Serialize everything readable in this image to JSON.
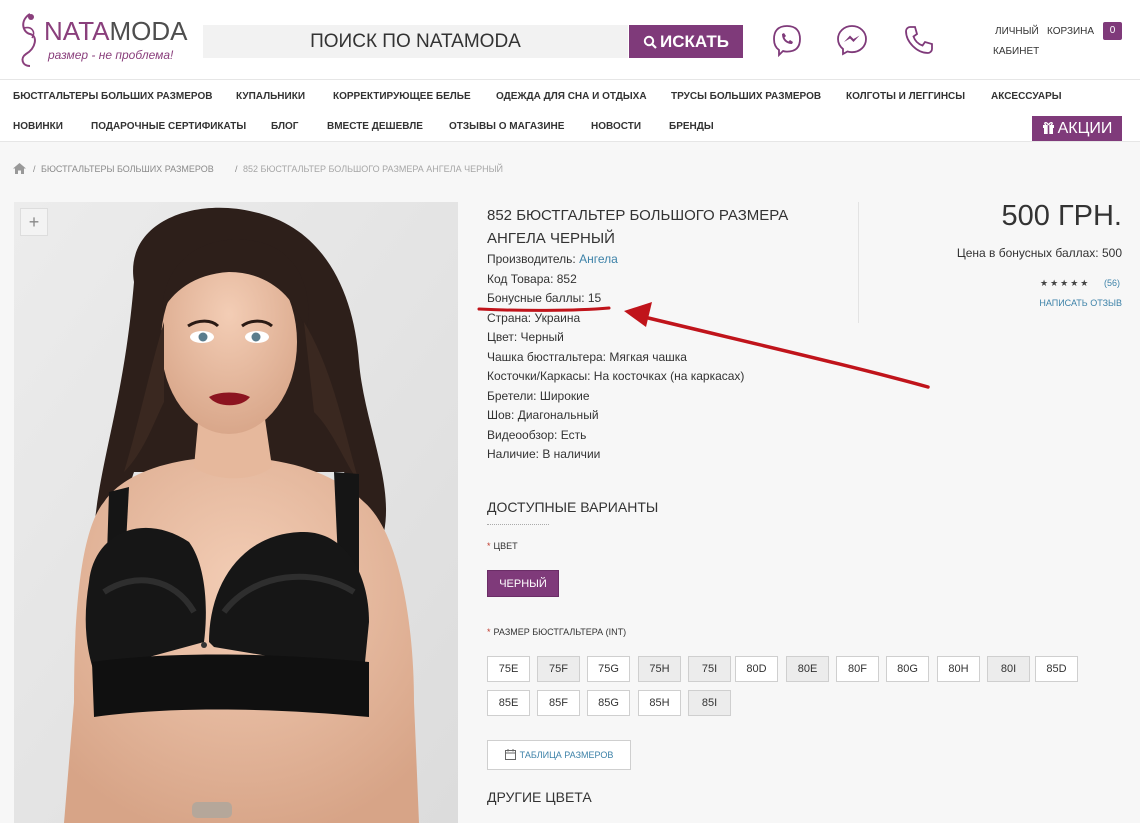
{
  "header": {
    "brand_a": "NATA",
    "brand_b": "MODA",
    "tagline": "размер - не проблема!",
    "search_placeholder": "ПОИСК ПО NATAMODA",
    "search_button": "ИСКАТЬ",
    "account_line1": "ЛИЧНЫЙ",
    "account_line2": "КАБИНЕТ",
    "cart_label": "КОРЗИНА",
    "cart_count": "0",
    "contact_icons": [
      "viber-icon",
      "messenger-icon",
      "phone-icon"
    ]
  },
  "nav": {
    "row1": [
      "БЮСТГАЛЬТЕРЫ БОЛЬШИХ РАЗМЕРОВ",
      "КУПАЛЬНИКИ",
      "КОРРЕКТИРУЮЩЕЕ БЕЛЬЕ",
      "ОДЕЖДА ДЛЯ СНА И ОТДЫХА",
      "ТРУСЫ БОЛЬШИХ РАЗМЕРОВ",
      "КОЛГОТЫ И ЛЕГГИНСЫ",
      "АКСЕССУАРЫ"
    ],
    "row2": [
      "НОВИНКИ",
      "ПОДАРОЧНЫЕ СЕРТИФИКАТЫ",
      "БЛОГ",
      "ВМЕСТЕ ДЕШЕВЛЕ",
      "ОТЗЫВЫ О МАГАЗИНЕ",
      "НОВОСТИ",
      "БРЕНДЫ"
    ],
    "promo": "АКЦИИ"
  },
  "breadcrumb": {
    "home_icon": "home-icon",
    "items": [
      "БЮСТГАЛЬТЕРЫ БОЛЬШИХ РАЗМЕРОВ",
      "852 БЮСТГАЛЬТЕР БОЛЬШОГО РАЗМЕРА АНГЕЛА ЧЕРНЫЙ"
    ]
  },
  "product": {
    "zoom": "+",
    "title_line1": "852 БЮСТГАЛЬТЕР БОЛЬШОГО РАЗМЕРА",
    "title_line2": "АНГЕЛА ЧЕРНЫЙ",
    "maker_label": "Производитель:",
    "maker_value": "Ангела",
    "specs": [
      "Код Товара: 852",
      "Бонусные баллы: 15",
      "Страна: Украина",
      "Цвет: Черный",
      "Чашка бюстгальтера: Мягкая чашка",
      "Косточки/Каркасы: На косточках (на каркасах)",
      "Бретели: Широкие",
      "Шов: Диагональный",
      "Видеообзор: Есть",
      "Наличие: В наличии"
    ],
    "price": "500 ГРН.",
    "bonus_price": "Цена в бонусных баллах: 500",
    "stars": "★★★★★",
    "rating": 5,
    "review_count": "(56)",
    "write_review": "НАПИСАТЬ ОТЗЫВ"
  },
  "options": {
    "title": "ДОСТУПНЫЕ ВАРИАНТЫ",
    "color_label": "ЦВЕТ",
    "color_value": "ЧЕРНЫЙ",
    "size_label": "РАЗМЕР БЮСТГАЛЬТЕРА (INT)",
    "sizes_row1": [
      "75E",
      "75F",
      "75G",
      "75H",
      "75I",
      "80D",
      "80E",
      "80F",
      "80G",
      "80H",
      "80I",
      "85D"
    ],
    "sizes_row2": [
      "85E",
      "85F",
      "85G",
      "85H",
      "85I"
    ],
    "size_table": "ТАБЛИЦА РАЗМЕРОВ",
    "other_colors": "ДРУГИЕ ЦВЕТА"
  },
  "colors": {
    "accent": "#7f3a7a",
    "link": "#3d82a8",
    "annotation": "#c0141b"
  }
}
